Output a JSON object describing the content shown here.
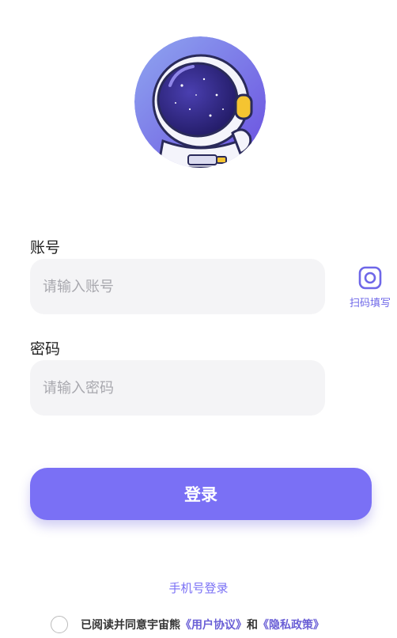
{
  "avatar": {
    "icon": "astronaut-avatar"
  },
  "account": {
    "label": "账号",
    "placeholder": "请输入账号",
    "value": ""
  },
  "password": {
    "label": "密码",
    "placeholder": "请输入密码",
    "value": ""
  },
  "scan": {
    "icon": "camera-icon",
    "label": "扫码填写"
  },
  "login_button": "登录",
  "phone_login": "手机号登录",
  "agreement": {
    "checked": false,
    "prefix": "已阅读并同意宇宙熊",
    "user_agreement": "《用户协议》",
    "conjunction": "和",
    "privacy_policy": "《隐私政策》"
  },
  "colors": {
    "accent": "#7a70f5",
    "input_bg": "#f4f4f6",
    "link": "#6a5fd6"
  }
}
